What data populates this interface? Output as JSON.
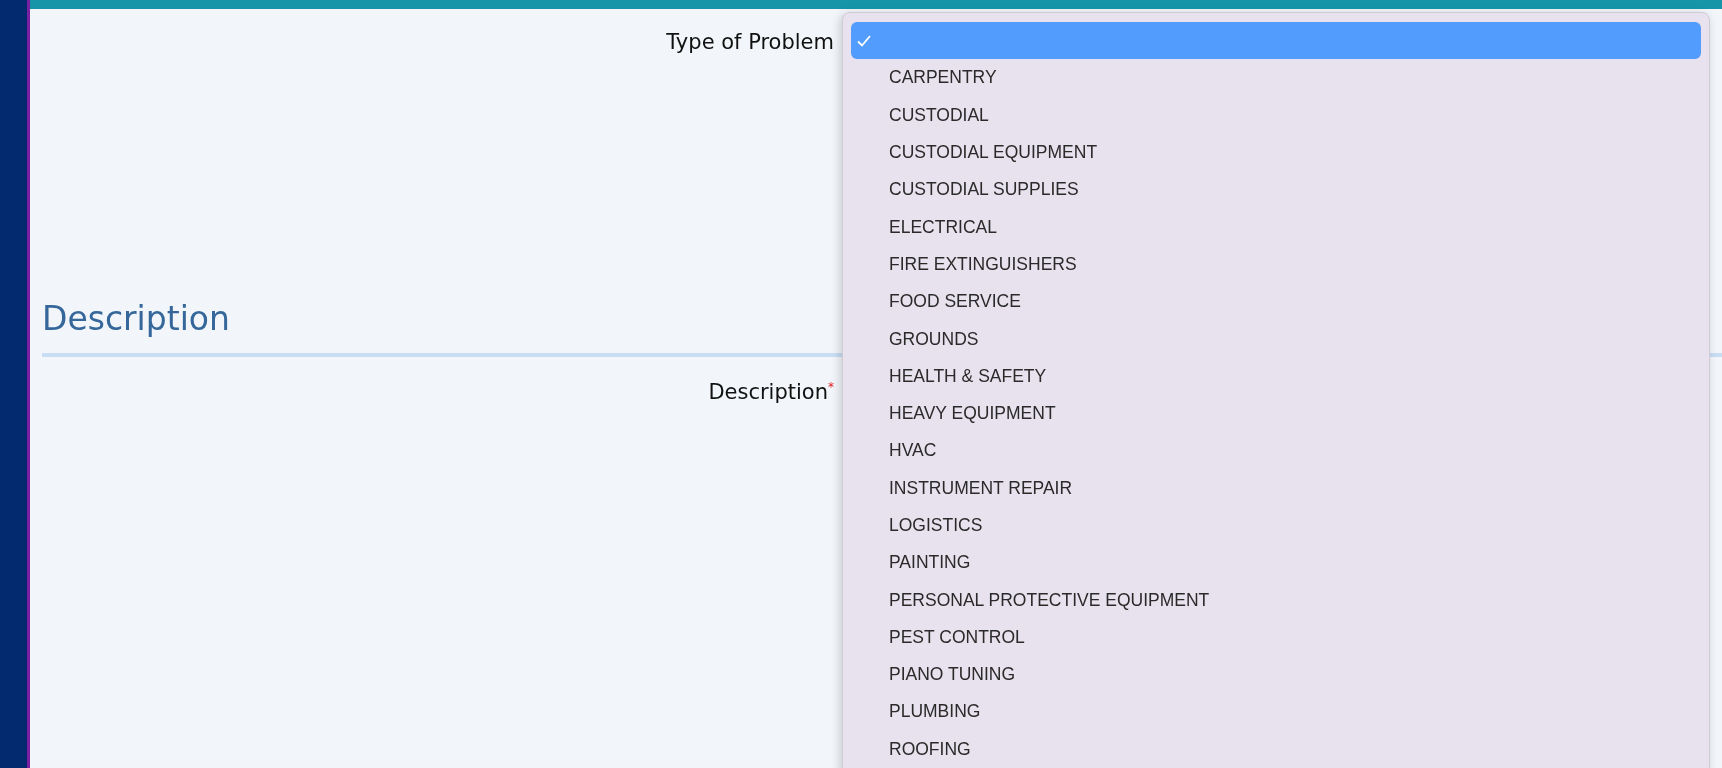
{
  "form": {
    "type_of_problem": {
      "label": "Type of Problem"
    },
    "section": {
      "heading": "Description"
    },
    "description": {
      "label": "Description",
      "required_mark": "*"
    }
  },
  "dropdown": {
    "options": [
      {
        "selected": true
      },
      {
        "label": "CARPENTRY",
        "selected": false
      },
      {
        "label": "CUSTODIAL",
        "selected": false
      },
      {
        "label": "CUSTODIAL EQUIPMENT",
        "selected": false
      },
      {
        "label": "CUSTODIAL SUPPLIES",
        "selected": false
      },
      {
        "label": "ELECTRICAL",
        "selected": false
      },
      {
        "label": "FIRE EXTINGUISHERS",
        "selected": false
      },
      {
        "label": "FOOD SERVICE",
        "selected": false
      },
      {
        "label": "GROUNDS",
        "selected": false
      },
      {
        "label": "HEALTH & SAFETY",
        "selected": false
      },
      {
        "label": "HEAVY EQUIPMENT",
        "selected": false
      },
      {
        "label": "HVAC",
        "selected": false
      },
      {
        "label": "INSTRUMENT REPAIR",
        "selected": false
      },
      {
        "label": "LOGISTICS",
        "selected": false
      },
      {
        "label": "PAINTING",
        "selected": false
      },
      {
        "label": "PERSONAL PROTECTIVE EQUIPMENT",
        "selected": false
      },
      {
        "label": "PEST CONTROL",
        "selected": false
      },
      {
        "label": "PIANO TUNING",
        "selected": false
      },
      {
        "label": "PLUMBING",
        "selected": false
      },
      {
        "label": "ROOFING",
        "selected": false
      }
    ]
  }
}
